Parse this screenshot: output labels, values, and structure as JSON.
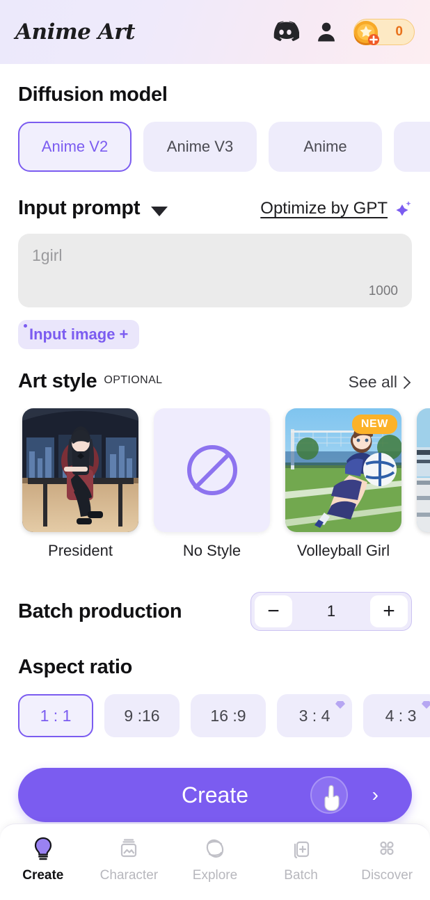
{
  "header": {
    "brand": "Anime Art",
    "icons": [
      "discord-icon",
      "profile-icon"
    ],
    "coin_count": "0",
    "coin_icon": "coin-star-icon",
    "add_icon": "plus-badge-icon"
  },
  "diffusion": {
    "title": "Diffusion model",
    "models": [
      {
        "label": "Anime V2",
        "selected": true
      },
      {
        "label": "Anime V3",
        "selected": false
      },
      {
        "label": "Anime",
        "selected": false
      },
      {
        "label": "",
        "selected": false
      }
    ]
  },
  "prompt": {
    "title": "Input prompt",
    "dropdown_icon": "caret-down-icon",
    "optimize_label": "Optimize by GPT",
    "optimize_icon": "sparkle-icon",
    "placeholder": "1girl",
    "value": "",
    "char_limit": "1000",
    "input_image_label": "Input image +"
  },
  "art_style": {
    "title": "Art style",
    "optional_tag": "OPTIONAL",
    "see_all": "See all",
    "see_all_icon": "chevron-right-icon",
    "cards": [
      {
        "label": "President",
        "badge": "",
        "kind": "image"
      },
      {
        "label": "No Style",
        "badge": "",
        "kind": "none"
      },
      {
        "label": "Volleyball Girl",
        "badge": "NEW",
        "kind": "image"
      },
      {
        "label": "",
        "badge": "",
        "kind": "image"
      }
    ]
  },
  "batch": {
    "title": "Batch production",
    "minus_label": "−",
    "value": "1",
    "plus_label": "+"
  },
  "aspect": {
    "title": "Aspect ratio",
    "options": [
      {
        "label": "1 : 1",
        "selected": true,
        "premium": false
      },
      {
        "label": "9 :16",
        "selected": false,
        "premium": false
      },
      {
        "label": "16 :9",
        "selected": false,
        "premium": false
      },
      {
        "label": "3 : 4",
        "selected": false,
        "premium": true
      },
      {
        "label": "4 : 3",
        "selected": false,
        "premium": true
      }
    ]
  },
  "create": {
    "label": "Create",
    "chevron": "›",
    "cursor_icon": "hand-pointer-icon"
  },
  "bottom_nav": [
    {
      "label": "Create",
      "icon": "lightbulb-icon",
      "active": true
    },
    {
      "label": "Character",
      "icon": "photo-card-icon",
      "active": false
    },
    {
      "label": "Explore",
      "icon": "planet-icon",
      "active": false
    },
    {
      "label": "Batch",
      "icon": "stacked-plus-icon",
      "active": false
    },
    {
      "label": "Discover",
      "icon": "clover-grid-icon",
      "active": false
    }
  ],
  "colors": {
    "accent": "#7b5cf0",
    "chip_bg": "#eeecfb",
    "new_badge": "#fcb229",
    "coin": "#f2a33c"
  }
}
